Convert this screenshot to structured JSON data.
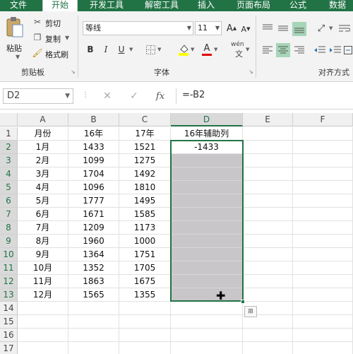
{
  "ribbon_tabs": [
    "文件",
    "开始",
    "开发工具",
    "解密工具",
    "插入",
    "页面布局",
    "公式",
    "数据"
  ],
  "active_tab": 1,
  "clipboard": {
    "paste_label": "粘贴",
    "cut_label": "剪切",
    "copy_label": "复制",
    "format_painter_label": "格式刷",
    "group_label": "剪贴板"
  },
  "font": {
    "font_name": "等线",
    "font_size": "11",
    "bold": "B",
    "italic": "I",
    "underline": "U",
    "phonetic": "wén",
    "group_label": "字体"
  },
  "alignment": {
    "group_label": "对齐方式"
  },
  "formula_bar": {
    "name_box": "D2",
    "formula": "=-B2"
  },
  "columns": [
    "A",
    "B",
    "C",
    "D",
    "E",
    "F"
  ],
  "selected_column": "D",
  "rows": [
    {
      "n": "1",
      "a": "月份",
      "b": "16年",
      "c": "17年",
      "d": "16年辅助列"
    },
    {
      "n": "2",
      "a": "1月",
      "b": "1433",
      "c": "1521",
      "d": "-1433"
    },
    {
      "n": "3",
      "a": "2月",
      "b": "1099",
      "c": "1275",
      "d": ""
    },
    {
      "n": "4",
      "a": "3月",
      "b": "1704",
      "c": "1492",
      "d": ""
    },
    {
      "n": "5",
      "a": "4月",
      "b": "1096",
      "c": "1810",
      "d": ""
    },
    {
      "n": "6",
      "a": "5月",
      "b": "1777",
      "c": "1495",
      "d": ""
    },
    {
      "n": "7",
      "a": "6月",
      "b": "1671",
      "c": "1585",
      "d": ""
    },
    {
      "n": "8",
      "a": "7月",
      "b": "1209",
      "c": "1173",
      "d": ""
    },
    {
      "n": "9",
      "a": "8月",
      "b": "1960",
      "c": "1000",
      "d": ""
    },
    {
      "n": "10",
      "a": "9月",
      "b": "1364",
      "c": "1751",
      "d": ""
    },
    {
      "n": "11",
      "a": "10月",
      "b": "1352",
      "c": "1705",
      "d": ""
    },
    {
      "n": "12",
      "a": "11月",
      "b": "1863",
      "c": "1675",
      "d": ""
    },
    {
      "n": "13",
      "a": "12月",
      "b": "1565",
      "c": "1355",
      "d": ""
    },
    {
      "n": "14",
      "a": "",
      "b": "",
      "c": "",
      "d": ""
    },
    {
      "n": "15",
      "a": "",
      "b": "",
      "c": "",
      "d": ""
    },
    {
      "n": "16",
      "a": "",
      "b": "",
      "c": "",
      "d": ""
    },
    {
      "n": "17",
      "a": "",
      "b": "",
      "c": "",
      "d": ""
    }
  ],
  "selection": {
    "first_row": 2,
    "last_row": 13,
    "col": "D"
  },
  "colors": {
    "accent": "#217346",
    "selection_fill": "#c8c6c8"
  }
}
